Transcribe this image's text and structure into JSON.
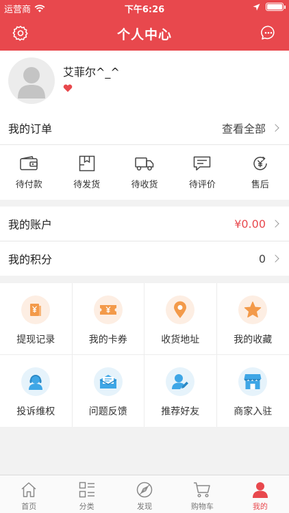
{
  "status_bar": {
    "carrier": "运营商",
    "time": "下午6:26"
  },
  "nav": {
    "title": "个人中心",
    "left_icon": "settings-icon",
    "right_icon": "message-icon"
  },
  "profile": {
    "username": "艾菲尔^_^"
  },
  "orders": {
    "label": "我的订单",
    "view_all": "查看全部",
    "items": [
      {
        "label": "待付款",
        "icon": "wallet-icon"
      },
      {
        "label": "待发货",
        "icon": "package-icon"
      },
      {
        "label": "待收货",
        "icon": "truck-icon"
      },
      {
        "label": "待评价",
        "icon": "comment-icon"
      },
      {
        "label": "售后",
        "icon": "refund-icon"
      }
    ]
  },
  "account": {
    "label": "我的账户",
    "value": "¥0.00"
  },
  "points": {
    "label": "我的积分",
    "value": "0"
  },
  "services": [
    {
      "label": "提现记录",
      "icon": "withdraw-icon",
      "tone": "orange"
    },
    {
      "label": "我的卡券",
      "icon": "coupon-icon",
      "tone": "orange"
    },
    {
      "label": "收货地址",
      "icon": "location-icon",
      "tone": "orange"
    },
    {
      "label": "我的收藏",
      "icon": "star-icon",
      "tone": "orange"
    },
    {
      "label": "投诉维权",
      "icon": "support-icon",
      "tone": "blue"
    },
    {
      "label": "问题反馈",
      "icon": "mail-icon",
      "tone": "blue"
    },
    {
      "label": "推荐好友",
      "icon": "recommend-icon",
      "tone": "blue"
    },
    {
      "label": "商家入驻",
      "icon": "store-icon",
      "tone": "blue"
    }
  ],
  "tabs": [
    {
      "label": "首页",
      "icon": "home-icon",
      "active": false
    },
    {
      "label": "分类",
      "icon": "category-icon",
      "active": false
    },
    {
      "label": "发现",
      "icon": "discover-icon",
      "active": false
    },
    {
      "label": "购物车",
      "icon": "cart-icon",
      "active": false
    },
    {
      "label": "我的",
      "icon": "profile-icon",
      "active": true
    }
  ],
  "colors": {
    "brand_red": "#e8484d",
    "orange": "#f39a4a",
    "blue": "#3ea6e6"
  }
}
